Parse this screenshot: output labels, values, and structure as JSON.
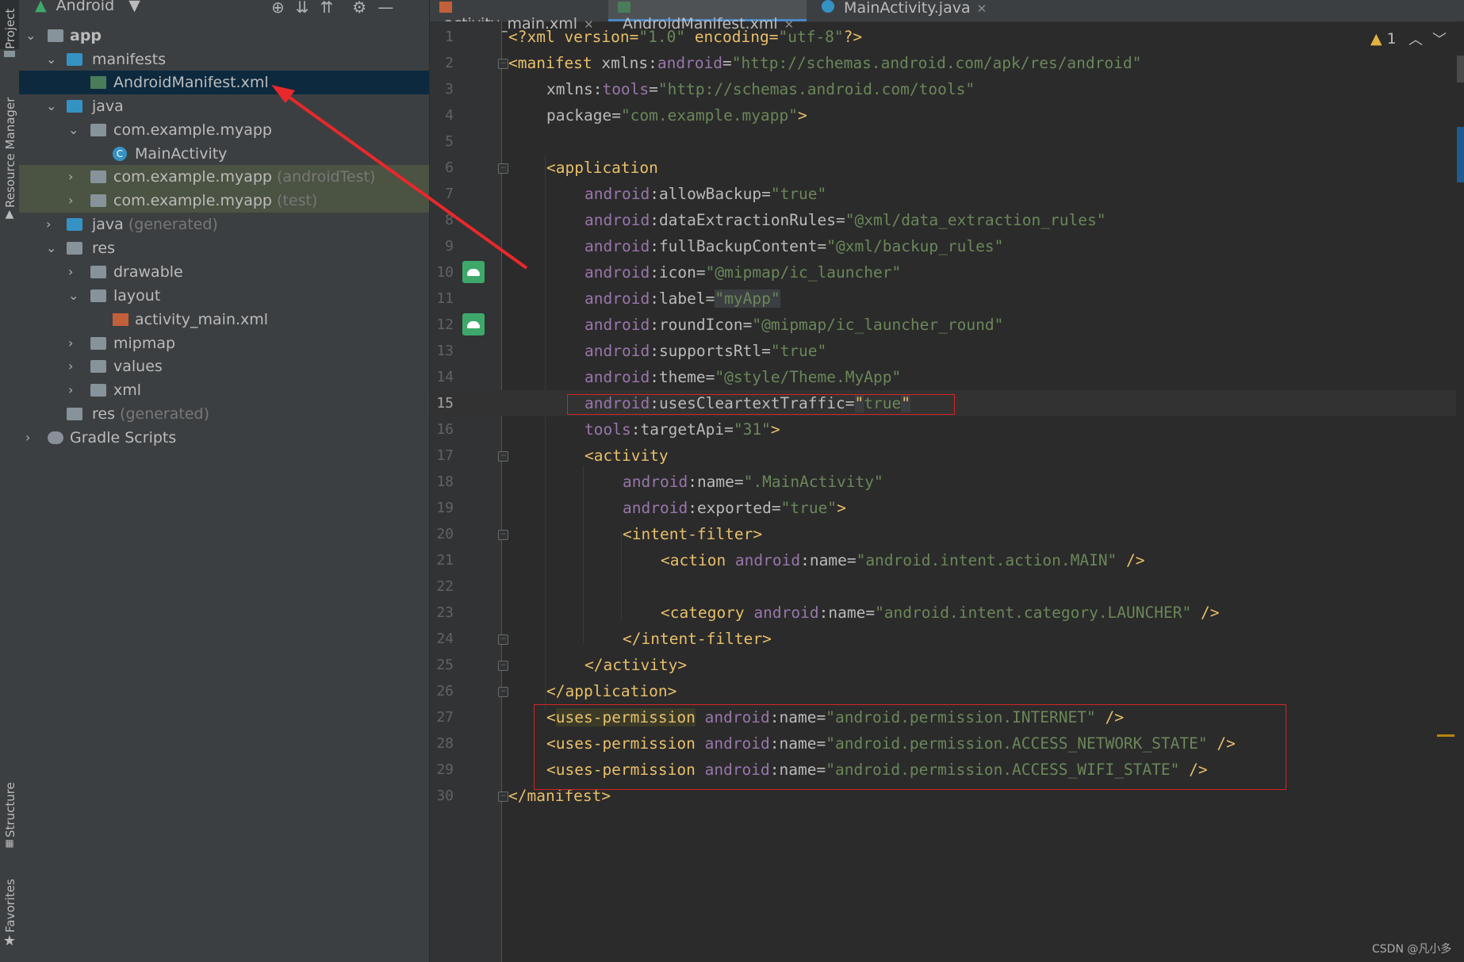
{
  "left_toolstrip": {
    "project": "Project",
    "resource_manager": "Resource Manager",
    "structure": "Structure",
    "favorites": "Favorites"
  },
  "project_panel": {
    "view_selector": "Android",
    "tree": [
      {
        "label": "app",
        "suffix": ""
      },
      {
        "label": "manifests",
        "suffix": ""
      },
      {
        "label": "AndroidManifest.xml",
        "suffix": ""
      },
      {
        "label": "java",
        "suffix": ""
      },
      {
        "label": "com.example.myapp",
        "suffix": ""
      },
      {
        "label": "MainActivity",
        "suffix": ""
      },
      {
        "label": "com.example.myapp",
        "suffix": "(androidTest)"
      },
      {
        "label": "com.example.myapp",
        "suffix": "(test)"
      },
      {
        "label": "java",
        "suffix": "(generated)"
      },
      {
        "label": "res",
        "suffix": ""
      },
      {
        "label": "drawable",
        "suffix": ""
      },
      {
        "label": "layout",
        "suffix": ""
      },
      {
        "label": "activity_main.xml",
        "suffix": ""
      },
      {
        "label": "mipmap",
        "suffix": ""
      },
      {
        "label": "values",
        "suffix": ""
      },
      {
        "label": "xml",
        "suffix": ""
      },
      {
        "label": "res",
        "suffix": "(generated)"
      },
      {
        "label": "Gradle Scripts",
        "suffix": ""
      }
    ]
  },
  "editor": {
    "tabs": [
      {
        "label": "activity_main.xml",
        "active": false
      },
      {
        "label": "AndroidManifest.xml",
        "active": true
      },
      {
        "label": "MainActivity.java",
        "active": false
      }
    ],
    "warning_count": "1",
    "current_line": 15,
    "line_numbers": [
      "1",
      "2",
      "3",
      "4",
      "5",
      "6",
      "7",
      "8",
      "9",
      "10",
      "11",
      "12",
      "13",
      "14",
      "15",
      "16",
      "17",
      "18",
      "19",
      "20",
      "21",
      "22",
      "23",
      "24",
      "25",
      "26",
      "27",
      "28",
      "29",
      "30"
    ],
    "code": {
      "l1_a": "<?xml version=",
      "l1_b": "\"1.0\"",
      "l1_c": " encoding=",
      "l1_d": "\"utf-8\"",
      "l1_e": "?>",
      "l2_tag": "<manifest ",
      "l2_attr": "xmlns:",
      "l2_ns": "android",
      "l2_eq": "=",
      "l2_val": "\"http://schemas.android.com/apk/res/android\"",
      "l3_attr": "xmlns:",
      "l3_ns": "tools",
      "l3_eq": "=",
      "l3_val": "\"http://schemas.android.com/tools\"",
      "l4_attr": "package",
      "l4_eq": "=",
      "l4_val": "\"com.example.myapp\"",
      "l4_end": ">",
      "l6_tag": "<application",
      "ns_android": "android",
      "colon": ":",
      "eq": "=",
      "l7_attr": "allowBackup",
      "l7_val": "\"true\"",
      "l8_attr": "dataExtractionRules",
      "l8_val": "\"@xml/data_extraction_rules\"",
      "l9_attr": "fullBackupContent",
      "l9_val": "\"@xml/backup_rules\"",
      "l10_attr": "icon",
      "l10_val": "\"@mipmap/ic_launcher\"",
      "l11_attr": "label",
      "l11_val": "\"myApp\"",
      "l12_attr": "roundIcon",
      "l12_val": "\"@mipmap/ic_launcher_round\"",
      "l13_attr": "supportsRtl",
      "l13_val": "\"true\"",
      "l14_attr": "theme",
      "l14_val": "\"@style/Theme.MyApp\"",
      "l15_attr": "usesCleartextTraffic",
      "l15_q1": "\"",
      "l15_val": "true",
      "l15_q2": "\"",
      "l16_ns": "tools",
      "l16_attr": "targetApi",
      "l16_val": "\"31\"",
      "l16_end": ">",
      "l17_tag": "<activity",
      "l18_attr": "name",
      "l18_val": "\".MainActivity\"",
      "l19_attr": "exported",
      "l19_val": "\"true\"",
      "l19_end": ">",
      "l20_tag": "<intent-filter>",
      "l21_tag": "<action ",
      "l21_attr": "name",
      "l21_val": "\"android.intent.action.MAIN\"",
      "l21_end": " />",
      "l23_tag": "<category ",
      "l23_attr": "name",
      "l23_val": "\"android.intent.category.LAUNCHER\"",
      "l23_end": " />",
      "l24_tag": "</intent-filter>",
      "l25_tag": "</activity>",
      "l26_tag": "</application>",
      "l27_lt": "<",
      "l27_name": "uses-permission",
      "l27_attr": "name",
      "l27_val": "\"android.permission.INTERNET\"",
      "l27_end": " />",
      "l28_tag": "<uses-permission ",
      "l28_attr": "name",
      "l28_val": "\"android.permission.ACCESS_NETWORK_STATE\"",
      "l28_end": " />",
      "l29_tag": "<uses-permission ",
      "l29_attr": "name",
      "l29_val": "\"android.permission.ACCESS_WIFI_STATE\"",
      "l29_end": " />",
      "l30_tag": "</manifest>"
    }
  },
  "watermark": "CSDN @凡小多"
}
